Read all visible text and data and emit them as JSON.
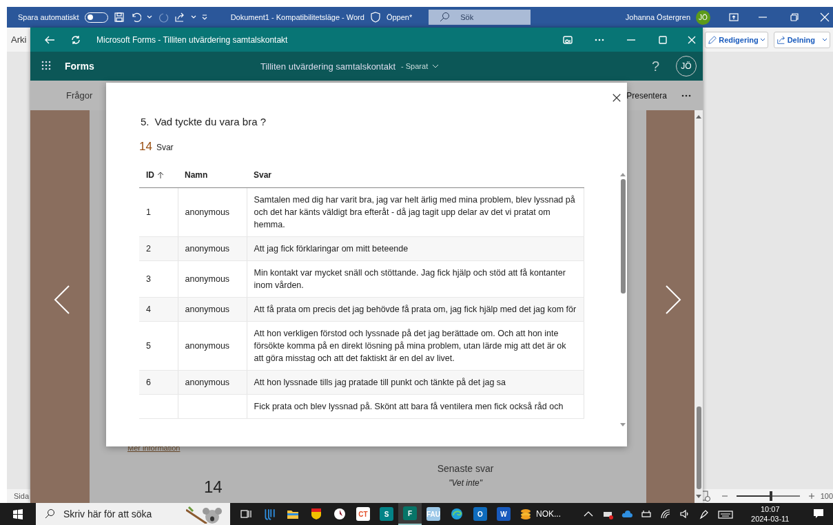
{
  "word": {
    "autosave_label": "Spara automatiskt",
    "autosave_on": false,
    "title": "Dokument1 - Kompatibilitetsläge - Word",
    "sensitivity": "Öppen*",
    "search_placeholder": "Sök",
    "user_name": "Johanna Östergren",
    "user_initials": "JÖ",
    "ribbon_tab": "Arki",
    "editing_button": "Redigering",
    "share_button": "Delning",
    "status_page": "Sida",
    "zoom": {
      "level": 0.55,
      "reading": "100"
    }
  },
  "forms_window": {
    "title": "Microsoft Forms - Tilliten utvärdering samtalskontakt",
    "app_name": "Forms",
    "form_title": "Tilliten utvärdering samtalskontakt",
    "save_state": "- Sparat",
    "help": "?",
    "user_initials": "JÖ",
    "toolbar_left": "Frågor",
    "toolbar_right": "Presentera",
    "more_info_link": "Mer information",
    "latest_heading": "Senaste svar",
    "latest_answer": "\"Vet inte\"",
    "response_total": "14"
  },
  "dialog": {
    "question_number": "5.",
    "question": "Vad tyckte du vara bra ?",
    "response_count": "14",
    "response_label": "Svar",
    "columns": [
      "ID",
      "Namn",
      "Svar"
    ],
    "rows": [
      {
        "id": "1",
        "name": "anonymous",
        "answer": "Samtalen med dig har varit bra, jag var helt ärlig med mina problem, blev lyssnad på och det har känts väldigt bra efteråt - då jag tagit upp delar av det vi pratat om hemma."
      },
      {
        "id": "2",
        "name": "anonymous",
        "answer": "Att jag fick förklaringar om mitt beteende"
      },
      {
        "id": "3",
        "name": "anonymous",
        "answer": "Min kontakt var mycket snäll och stöttande. Jag fick hjälp och stöd att få kontanter inom vården."
      },
      {
        "id": "4",
        "name": "anonymous",
        "answer": "Att få prata om precis det jag behövde få prata om, jag fick hjälp med det jag kom för"
      },
      {
        "id": "5",
        "name": "anonymous",
        "answer": "Att hon verkligen förstod och lyssnade på det jag berättade om. Och att hon inte försökte komma på en direkt lösning på mina problem, utan lärde mig att det är ok att göra misstag och att det faktiskt är en del av livet."
      },
      {
        "id": "6",
        "name": "anonymous",
        "answer": "Att hon lyssnade tills jag pratade till punkt och tänkte på det jag sa"
      },
      {
        "answer": "Fick prata och blev lyssnad på. Skönt att bara få ventilera men fick också råd och"
      }
    ]
  },
  "taskbar": {
    "search_placeholder": "Skriv här för att söka",
    "apps": [
      {
        "kind": "taskview",
        "selected": false
      },
      {
        "kind": "jl",
        "selected": false
      },
      {
        "kind": "folder",
        "selected": false
      },
      {
        "kind": "crest",
        "selected": false
      },
      {
        "kind": "clock",
        "selected": false
      },
      {
        "kind": "tile",
        "label": "CT",
        "color": "#ffffff",
        "selected": false
      },
      {
        "kind": "tile",
        "label": "S",
        "color": "#038387",
        "selected": false
      },
      {
        "kind": "tile",
        "label": "F",
        "color": "#077568",
        "selected": true
      },
      {
        "kind": "tile",
        "label": "FAU",
        "color": "#9cc8e8",
        "selected": false
      },
      {
        "kind": "edge",
        "selected": false
      },
      {
        "kind": "tile",
        "label": "O",
        "color": "#0f6cbd",
        "selected": false
      },
      {
        "kind": "tile",
        "label": "W",
        "color": "#185abd",
        "selected": false
      },
      {
        "kind": "coins",
        "label": "NOK...",
        "selected": false
      }
    ],
    "time": "10:07",
    "date": "2024-03-11"
  }
}
